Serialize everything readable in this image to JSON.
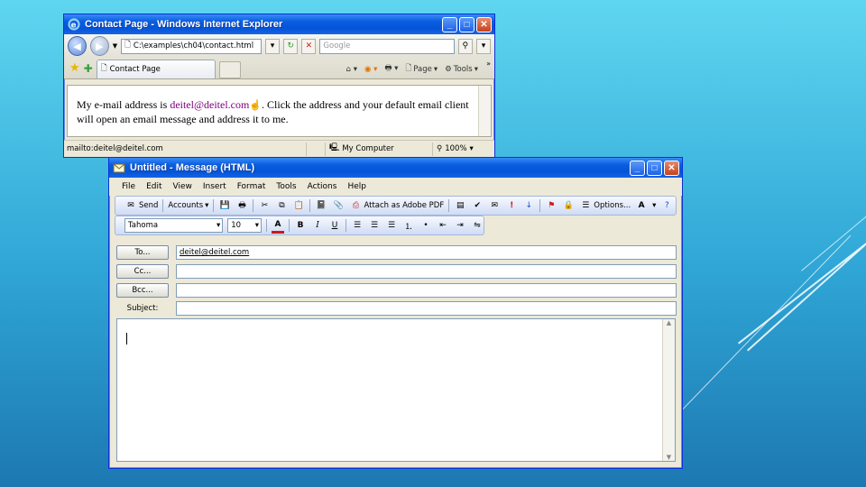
{
  "ie": {
    "title": "Contact Page - Windows Internet Explorer",
    "address": "C:\\examples\\ch04\\contact.html",
    "search_placeholder": "Google",
    "tab_label": "Contact Page",
    "cmd_page": "Page",
    "cmd_tools": "Tools",
    "content_before": "My e-mail address is ",
    "content_link": "deitel@deitel.com",
    "content_after": ". Click the address and your default email client will open an email message and address it to me.",
    "status_url": "mailto:deitel@deitel.com",
    "status_zone": "My Computer",
    "status_zoom": "100%"
  },
  "msg": {
    "title": "Untitled - Message (HTML)",
    "menu": [
      "File",
      "Edit",
      "View",
      "Insert",
      "Format",
      "Tools",
      "Actions",
      "Help"
    ],
    "toolbar": {
      "send": "Send",
      "accounts": "Accounts",
      "attach_pdf": "Attach as Adobe PDF",
      "options": "Options..."
    },
    "format": {
      "font": "Tahoma",
      "size": "10"
    },
    "to_label": "To...",
    "cc_label": "Cc...",
    "bcc_label": "Bcc...",
    "subject_label": "Subject:",
    "to_value": "deitel@deitel.com",
    "cc_value": "",
    "bcc_value": "",
    "subject_value": ""
  },
  "colors": {
    "link_visited": "#800080",
    "titlebar_blue": "#0554d8",
    "toolbar_blue": "#cfdcf5"
  }
}
